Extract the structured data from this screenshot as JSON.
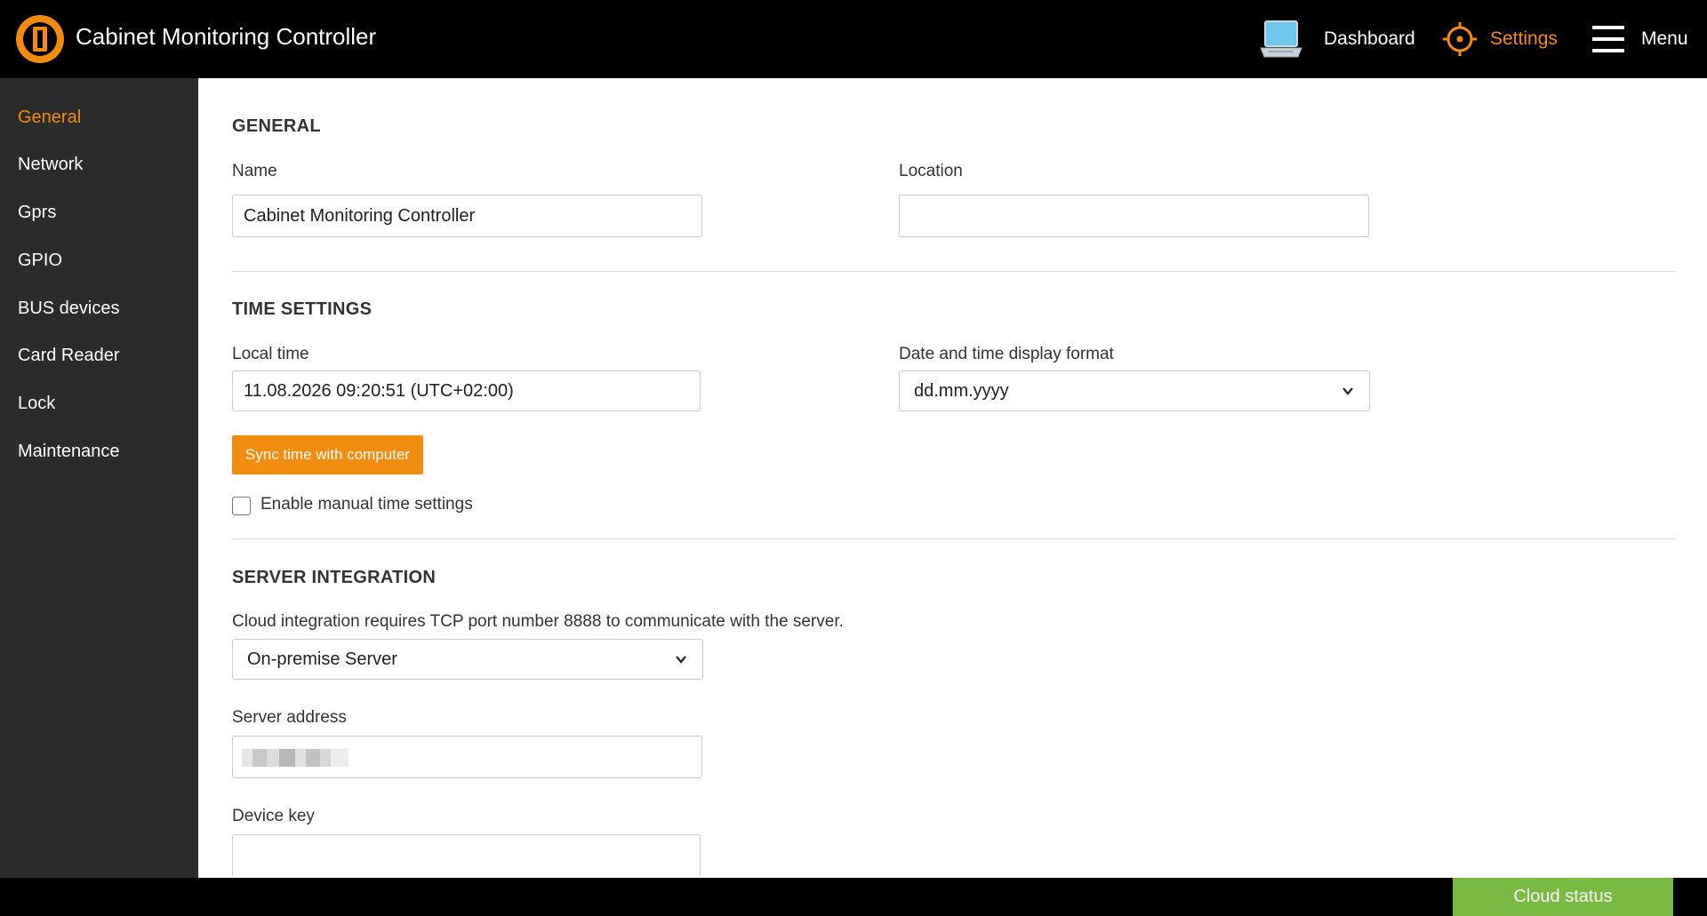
{
  "header": {
    "app_title": "Cabinet Monitoring Controller",
    "logo_icon": "brand-logo-icon",
    "nav": {
      "dashboard_label": "Dashboard",
      "settings_label": "Settings",
      "menu_label": "Menu"
    }
  },
  "sidebar": {
    "items": [
      {
        "label": "General",
        "active": true
      },
      {
        "label": "Network"
      },
      {
        "label": "Gprs"
      },
      {
        "label": "GPIO"
      },
      {
        "label": "BUS devices"
      },
      {
        "label": "Card Reader"
      },
      {
        "label": "Lock"
      },
      {
        "label": "Maintenance"
      }
    ]
  },
  "general": {
    "title": "GENERAL",
    "name_label": "Name",
    "name_value": "Cabinet Monitoring Controller",
    "location_label": "Location",
    "location_value": ""
  },
  "time": {
    "title": "TIME SETTINGS",
    "local_time_label": "Local time",
    "local_time_value": "11.08.2026 09:20:51 (UTC+02:00)",
    "format_label": "Date and time display format",
    "format_value": "dd.mm.yyyy",
    "sync_button": "Sync time with computer",
    "manual_label": "Enable manual time settings",
    "manual_checked": false
  },
  "server": {
    "title": "SERVER INTEGRATION",
    "note": "Cloud integration requires TCP port number 8888 to communicate with the server.",
    "mode_value": "On-premise Server",
    "address_label": "Server address",
    "device_key_label": "Device key"
  },
  "footer": {
    "cloud_status_label": "Cloud status"
  },
  "colors": {
    "accent": "#f28c0f",
    "cloud_green": "#78b941",
    "sidebar_bg": "#2b2b2b",
    "header_bg": "#000000"
  }
}
